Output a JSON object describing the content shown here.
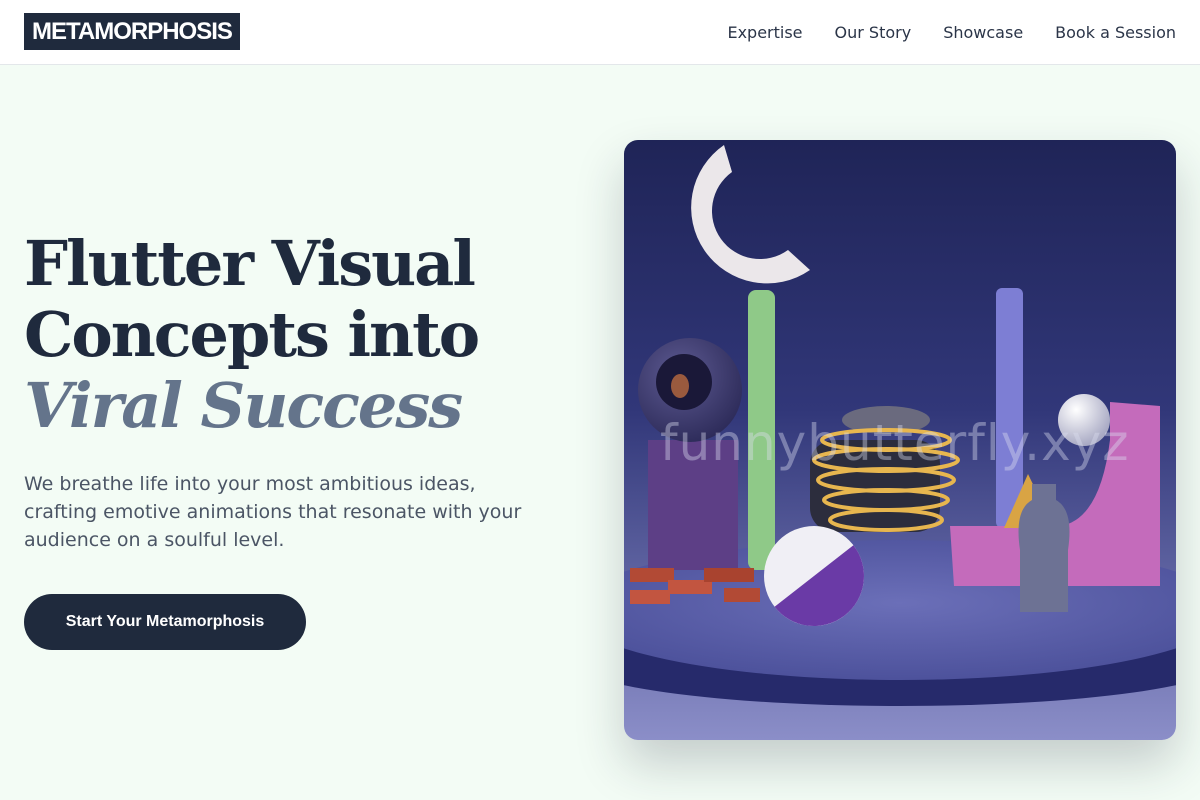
{
  "header": {
    "logo": "METAMORPHOSIS",
    "nav": [
      "Expertise",
      "Our Story",
      "Showcase",
      "Book a Session"
    ]
  },
  "hero": {
    "title_line1": "Flutter Visual",
    "title_line2": "Concepts into",
    "title_accent": "Viral Success",
    "subtitle": "We breathe life into your most ambitious ideas, crafting emotive animations that resonate with your audience on a soulful level.",
    "cta_label": "Start Your Metamorphosis"
  },
  "image": {
    "watermark": "funnybutterfly.xyz"
  }
}
